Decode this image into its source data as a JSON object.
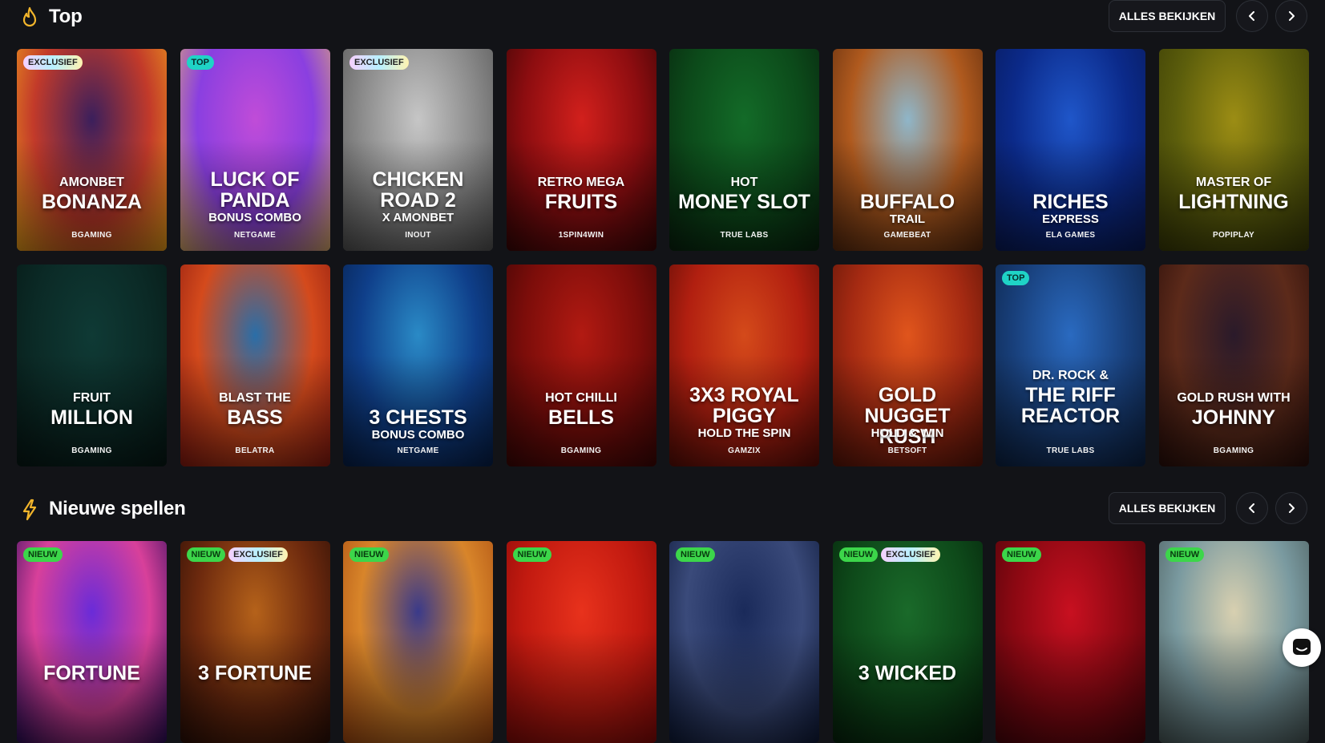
{
  "sections": {
    "top": {
      "title": "Top",
      "see_all_label": "ALLES BEKIJKEN",
      "icon": "flame-icon"
    },
    "new": {
      "title": "Nieuwe spellen",
      "see_all_label": "ALLES BEKIJKEN",
      "icon": "lightning-icon"
    }
  },
  "top_games": [
    {
      "badges": [
        "EXCLUSIEF"
      ],
      "line1": "AMONBET",
      "line2": "BONANZA",
      "line3": "",
      "provider": "BGAMING"
    },
    {
      "badges": [
        "TOP"
      ],
      "line1": "",
      "line2": "LUCK OF PANDA",
      "line3": "BONUS COMBO",
      "provider": "NETGAME"
    },
    {
      "badges": [
        "EXCLUSIEF"
      ],
      "line1": "",
      "line2": "CHICKEN ROAD 2",
      "line3": "X AMONBET",
      "provider": "INOUT"
    },
    {
      "badges": [],
      "line1": "RETRO MEGA",
      "line2": "FRUITS",
      "line3": "",
      "provider": "1SPIN4WIN"
    },
    {
      "badges": [],
      "line1": "HOT",
      "line2": "MONEY SLOT",
      "line3": "",
      "provider": "TRUE LABS"
    },
    {
      "badges": [],
      "line1": "",
      "line2": "BUFFALO",
      "line3": "TRAIL",
      "provider": "GAMEBEAT"
    },
    {
      "badges": [],
      "line1": "",
      "line2": "RICHES",
      "line3": "EXPRESS",
      "provider": "ELA GAMES"
    },
    {
      "badges": [],
      "line1": "MASTER OF",
      "line2": "LIGHTNING",
      "line3": "",
      "provider": "POPIPLAY"
    },
    {
      "badges": [],
      "line1": "FRUIT",
      "line2": "MILLION",
      "line3": "",
      "provider": "BGAMING"
    },
    {
      "badges": [],
      "line1": "BLAST THE",
      "line2": "BASS",
      "line3": "",
      "provider": "BELATRA"
    },
    {
      "badges": [],
      "line1": "",
      "line2": "3 CHESTS",
      "line3": "BONUS COMBO",
      "provider": "NETGAME"
    },
    {
      "badges": [],
      "line1": "HOT CHILLI",
      "line2": "BELLS",
      "line3": "",
      "provider": "BGAMING"
    },
    {
      "badges": [],
      "line1": "",
      "line2": "3X3 ROYAL PIGGY",
      "line3": "HOLD THE SPIN",
      "provider": "GAMZIX"
    },
    {
      "badges": [],
      "line1": "",
      "line2": "GOLD NUGGET RUSH",
      "line3": "HOLD & WIN",
      "provider": "BETSOFT"
    },
    {
      "badges": [
        "TOP"
      ],
      "line1": "DR. ROCK &",
      "line2": "THE RIFF REACTOR",
      "line3": "",
      "provider": "TRUE LABS"
    },
    {
      "badges": [],
      "line1": "GOLD RUSH WITH",
      "line2": "JOHNNY",
      "line3": "",
      "provider": "BGAMING"
    }
  ],
  "new_games": [
    {
      "badges": [
        "NIEUW"
      ],
      "line2": "FORTUNE"
    },
    {
      "badges": [
        "NIEUW",
        "EXCLUSIEF"
      ],
      "line2": "3 FORTUNE"
    },
    {
      "badges": [
        "NIEUW"
      ],
      "line2": ""
    },
    {
      "badges": [
        "NIEUW"
      ],
      "line2": ""
    },
    {
      "badges": [
        "NIEUW"
      ],
      "line2": ""
    },
    {
      "badges": [
        "NIEUW",
        "EXCLUSIEF"
      ],
      "line2": "3 WICKED"
    },
    {
      "badges": [
        "NIEUW"
      ],
      "line2": ""
    },
    {
      "badges": [
        "NIEUW"
      ],
      "line2": ""
    }
  ],
  "colors": {
    "background": "#121317",
    "badge_top": "#1fd3c6",
    "badge_new": "#3cd64a",
    "icon_gold": "#f2b52b"
  },
  "card_art": [
    [
      "#3b1f5c",
      "#c23a2a",
      "#f2a51a"
    ],
    [
      "#c04cd8",
      "#8a3fe0",
      "#e2b06c"
    ],
    [
      "#c6c6c6",
      "#8a8a8a",
      "#555"
    ],
    [
      "#d2201c",
      "#8d0d10",
      "#3a0505"
    ],
    [
      "#136b28",
      "#0c4a1a",
      "#08240e"
    ],
    [
      "#8fb6c9",
      "#b05a1e",
      "#5a2a0e"
    ],
    [
      "#1f56c9",
      "#0b2a8a",
      "#091a5a"
    ],
    [
      "#9c8d14",
      "#5c5e0c",
      "#3a3c06"
    ],
    [
      "#0f3a35",
      "#0b2a26",
      "#061815"
    ],
    [
      "#2a6ea8",
      "#d44a1c",
      "#8d1a10"
    ],
    [
      "#2a8ac6",
      "#0f3f8a",
      "#061f4a"
    ],
    [
      "#b21a12",
      "#7c0d0a",
      "#3e0605"
    ],
    [
      "#d44a1a",
      "#b11f10",
      "#5a0d06"
    ],
    [
      "#e0551c",
      "#a52a12",
      "#5a1408"
    ],
    [
      "#2a6ac0",
      "#183f7a",
      "#0c2244"
    ],
    [
      "#2a1a2a",
      "#5c2a1a",
      "#2a0e0a"
    ]
  ],
  "new_art": [
    [
      "#6a2bd8",
      "#d8409a",
      "#2a0c5a"
    ],
    [
      "#b5621a",
      "#6e2a0e",
      "#2a0e06"
    ],
    [
      "#3a3a8a",
      "#d8852a",
      "#a84a10"
    ],
    [
      "#e8321c",
      "#c21a10",
      "#8a0a08"
    ],
    [
      "#1a2a5a",
      "#3a4a7a",
      "#0e1a3a"
    ],
    [
      "#1a6a2a",
      "#0e4a1a",
      "#06240c"
    ],
    [
      "#c81020",
      "#8a0812",
      "#4a040a"
    ],
    [
      "#d8d0b0",
      "#7a9aa0",
      "#4a5a5a"
    ]
  ]
}
